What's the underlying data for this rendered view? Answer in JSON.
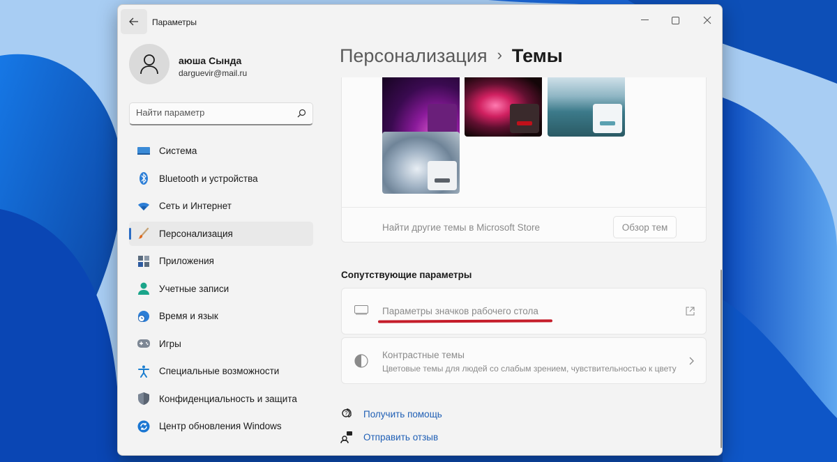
{
  "app": {
    "title": "Параметры"
  },
  "colors": {
    "accent": "#2b6cc4",
    "link": "#1f5fb5",
    "annotation": "#c51d2a"
  },
  "user": {
    "name": "аюша Сында",
    "email": "darguevir@mail.ru"
  },
  "search": {
    "placeholder": "Найти параметр"
  },
  "sidebar": {
    "items": [
      {
        "label": "Система",
        "icon": "monitor-icon",
        "active": false
      },
      {
        "label": "Bluetooth и устройства",
        "icon": "bluetooth-icon",
        "active": false
      },
      {
        "label": "Сеть и Интернет",
        "icon": "wifi-icon",
        "active": false
      },
      {
        "label": "Персонализация",
        "icon": "brush-icon",
        "active": true
      },
      {
        "label": "Приложения",
        "icon": "apps-icon",
        "active": false
      },
      {
        "label": "Учетные записи",
        "icon": "person-icon",
        "active": false
      },
      {
        "label": "Время и язык",
        "icon": "globe-clock-icon",
        "active": false
      },
      {
        "label": "Игры",
        "icon": "gamepad-icon",
        "active": false
      },
      {
        "label": "Специальные возможности",
        "icon": "accessibility-icon",
        "active": false
      },
      {
        "label": "Конфиденциальность и защита",
        "icon": "shield-icon",
        "active": false
      },
      {
        "label": "Центр обновления Windows",
        "icon": "update-icon",
        "active": false
      }
    ]
  },
  "header": {
    "parent": "Персонализация",
    "separator": "›",
    "current": "Темы"
  },
  "themes": {
    "store_text": "Найти другие темы в Microsoft Store",
    "browse_button": "Обзор тем",
    "tiles": [
      {
        "name": "glow-theme",
        "accent": "#5a1070"
      },
      {
        "name": "captured-motion-theme",
        "accent": "#c0101a"
      },
      {
        "name": "flow-theme",
        "accent": "#5aa0b0"
      },
      {
        "name": "sunrise-theme",
        "accent": "#5a6068"
      }
    ]
  },
  "related": {
    "title": "Сопутствующие параметры",
    "desktop_icons": {
      "title": "Параметры значков рабочего стола",
      "icon": "desktop-icon",
      "trail_icon": "external-link-icon"
    },
    "contrast": {
      "title": "Контрастные темы",
      "subtitle": "Цветовые темы для людей со слабым зрением, чувствительностью к цвету",
      "icon": "contrast-icon",
      "trail_icon": "chevron-right-icon"
    }
  },
  "help": {
    "get_help": "Получить помощь",
    "feedback": "Отправить отзыв"
  }
}
